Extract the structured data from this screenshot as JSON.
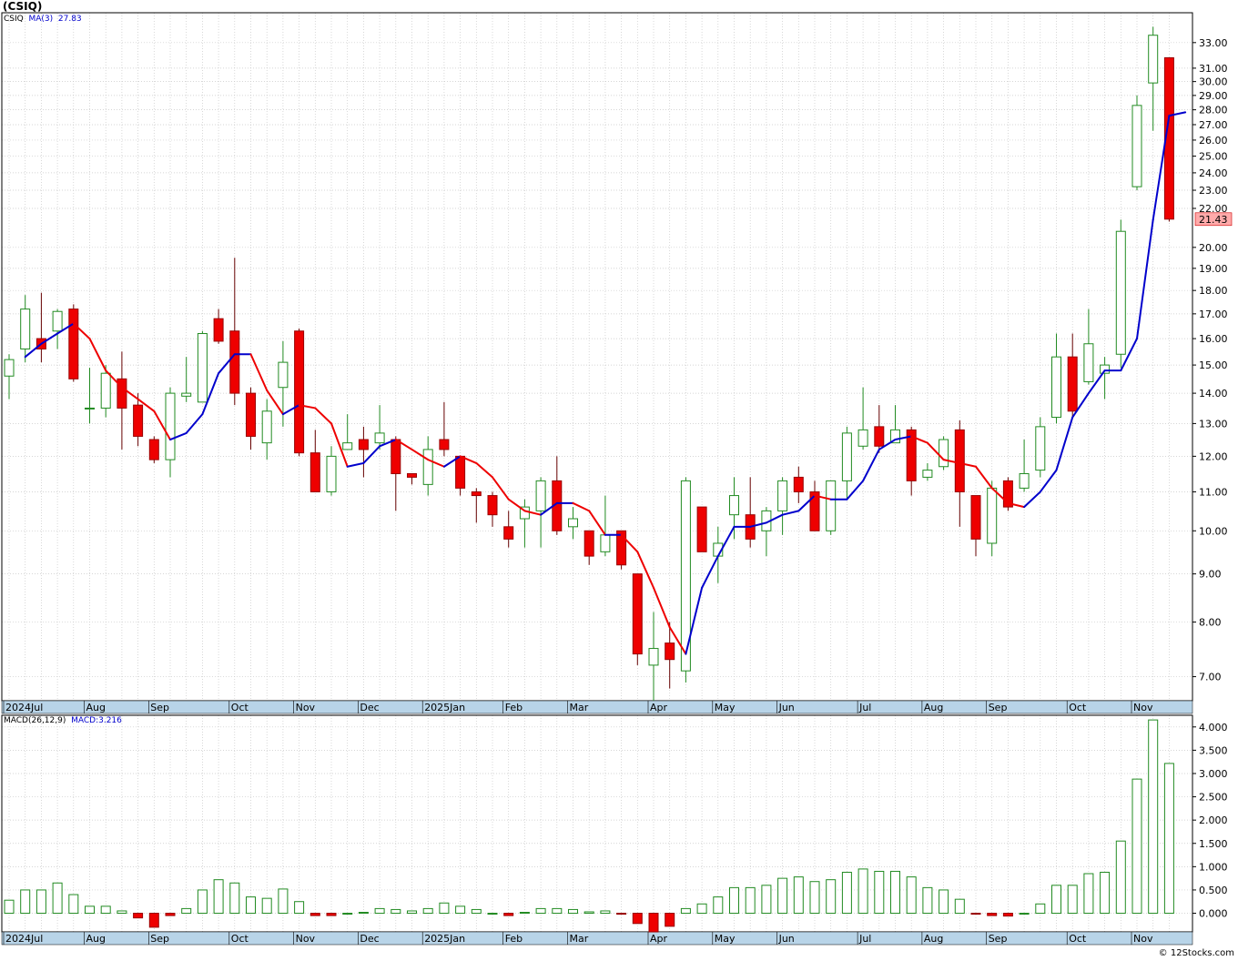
{
  "header": {
    "title": "(CSIQ)",
    "price_symbol": "CSIQ",
    "ma_label": "MA(3)",
    "ma_value": "27.83",
    "macd_label": "MACD(26,12,9)",
    "macd_value": "MACD:3.216",
    "last_price": "21.43",
    "copyright": "© 12Stocks.com"
  },
  "colors": {
    "up_candle": "#228b22",
    "down_candle": "#ee0000",
    "ma_rising": "#0000cc",
    "ma_falling": "#ee0000",
    "axis_band": "#b8d4e8",
    "price_marker": "#ffaaaa"
  },
  "chart_data": {
    "type": "candlestick",
    "y_scale": "log",
    "ylim": [
      6.6,
      35.5
    ],
    "price_ticks": [
      "7.00",
      "8.00",
      "9.00",
      "10.00",
      "11.00",
      "12.00",
      "13.00",
      "14.00",
      "15.00",
      "16.00",
      "17.00",
      "18.00",
      "19.00",
      "20.00",
      "22.00",
      "23.00",
      "24.00",
      "25.00",
      "26.00",
      "27.00",
      "28.00",
      "29.00",
      "30.00",
      "31.00",
      "33.00"
    ],
    "macd_ticks": [
      "0.000",
      "0.500",
      "1.000",
      "1.500",
      "2.000",
      "2.500",
      "3.000",
      "3.500",
      "4.000"
    ],
    "macd_ylim": [
      -0.4,
      4.25
    ],
    "x_labels": [
      {
        "label": "2024Jul",
        "week": 0
      },
      {
        "label": "Aug",
        "week": 5
      },
      {
        "label": "Sep",
        "week": 9
      },
      {
        "label": "Oct",
        "week": 14
      },
      {
        "label": "Nov",
        "week": 18
      },
      {
        "label": "Dec",
        "week": 22
      },
      {
        "label": "2025Jan",
        "week": 26
      },
      {
        "label": "Feb",
        "week": 31
      },
      {
        "label": "Mar",
        "week": 35
      },
      {
        "label": "Apr",
        "week": 40
      },
      {
        "label": "May",
        "week": 44
      },
      {
        "label": "Jun",
        "week": 48
      },
      {
        "label": "Jul",
        "week": 53
      },
      {
        "label": "Aug",
        "week": 57
      },
      {
        "label": "Sep",
        "week": 61
      },
      {
        "label": "Oct",
        "week": 66
      },
      {
        "label": "Nov",
        "week": 70
      }
    ],
    "candles": [
      [
        14.6,
        15.4,
        13.8,
        15.2
      ],
      [
        15.6,
        17.8,
        15.1,
        17.2
      ],
      [
        16.0,
        17.9,
        15.1,
        15.6
      ],
      [
        16.3,
        17.2,
        15.6,
        17.1
      ],
      [
        17.2,
        17.4,
        14.4,
        14.5
      ],
      [
        13.5,
        14.9,
        13.0,
        13.5
      ],
      [
        13.5,
        15.0,
        13.2,
        14.7
      ],
      [
        14.5,
        15.5,
        12.2,
        13.5
      ],
      [
        13.6,
        14.0,
        12.3,
        12.6
      ],
      [
        12.5,
        12.6,
        11.8,
        11.9
      ],
      [
        11.9,
        14.2,
        11.4,
        14.0
      ],
      [
        13.9,
        15.3,
        13.7,
        14.0
      ],
      [
        13.7,
        16.3,
        13.7,
        16.2
      ],
      [
        16.8,
        17.2,
        15.8,
        15.9
      ],
      [
        16.3,
        19.5,
        13.6,
        14.0
      ],
      [
        14.0,
        14.2,
        12.2,
        12.6
      ],
      [
        12.4,
        13.8,
        11.9,
        13.4
      ],
      [
        14.2,
        15.9,
        12.9,
        15.1
      ],
      [
        16.3,
        16.4,
        12.0,
        12.1
      ],
      [
        12.1,
        12.8,
        11.0,
        11.0
      ],
      [
        11.0,
        12.3,
        10.9,
        12.0
      ],
      [
        12.2,
        13.3,
        12.2,
        12.4
      ],
      [
        12.5,
        12.9,
        11.4,
        12.2
      ],
      [
        12.4,
        13.6,
        12.2,
        12.7
      ],
      [
        12.5,
        12.6,
        10.5,
        11.5
      ],
      [
        11.5,
        11.5,
        11.2,
        11.4
      ],
      [
        11.2,
        12.6,
        10.9,
        12.2
      ],
      [
        12.5,
        13.7,
        12.0,
        12.2
      ],
      [
        12.0,
        12.0,
        10.9,
        11.1
      ],
      [
        11.0,
        11.1,
        10.2,
        10.9
      ],
      [
        10.9,
        11.0,
        10.1,
        10.4
      ],
      [
        10.1,
        10.5,
        9.6,
        9.8
      ],
      [
        10.3,
        10.8,
        9.6,
        10.6
      ],
      [
        10.5,
        11.4,
        9.6,
        11.3
      ],
      [
        11.3,
        12.0,
        9.9,
        10.0
      ],
      [
        10.1,
        10.6,
        9.8,
        10.3
      ],
      [
        10.0,
        10.0,
        9.2,
        9.4
      ],
      [
        9.5,
        10.9,
        9.4,
        9.9
      ],
      [
        10.0,
        10.0,
        9.1,
        9.2
      ],
      [
        9.0,
        9.0,
        7.2,
        7.4
      ],
      [
        7.2,
        8.2,
        6.6,
        7.5
      ],
      [
        7.6,
        8.0,
        6.8,
        7.3
      ],
      [
        7.1,
        11.4,
        6.9,
        11.3
      ],
      [
        10.6,
        10.6,
        9.5,
        9.5
      ],
      [
        9.4,
        10.1,
        8.8,
        9.7
      ],
      [
        10.4,
        11.4,
        9.8,
        10.9
      ],
      [
        10.4,
        11.4,
        9.6,
        9.8
      ],
      [
        10.0,
        10.6,
        9.4,
        10.5
      ],
      [
        10.5,
        11.4,
        9.9,
        11.3
      ],
      [
        11.4,
        11.7,
        10.7,
        11.0
      ],
      [
        11.0,
        11.3,
        10.0,
        10.0
      ],
      [
        10.0,
        11.3,
        9.9,
        11.3
      ],
      [
        11.3,
        12.9,
        10.8,
        12.7
      ],
      [
        12.3,
        14.2,
        12.2,
        12.8
      ],
      [
        12.9,
        13.6,
        12.1,
        12.3
      ],
      [
        12.4,
        13.6,
        12.4,
        12.8
      ],
      [
        12.8,
        12.9,
        10.9,
        11.3
      ],
      [
        11.4,
        11.8,
        11.3,
        11.6
      ],
      [
        11.7,
        12.6,
        11.6,
        12.5
      ],
      [
        12.8,
        13.1,
        10.1,
        11.0
      ],
      [
        10.9,
        10.9,
        9.4,
        9.8
      ],
      [
        9.7,
        11.3,
        9.4,
        11.1
      ],
      [
        11.3,
        11.4,
        10.5,
        10.6
      ],
      [
        11.1,
        12.5,
        11.0,
        11.5
      ],
      [
        11.6,
        13.2,
        11.4,
        12.9
      ],
      [
        13.2,
        16.2,
        13.0,
        15.3
      ],
      [
        15.3,
        16.2,
        13.2,
        13.4
      ],
      [
        14.4,
        17.2,
        14.3,
        15.8
      ],
      [
        14.7,
        15.3,
        13.8,
        15.0
      ],
      [
        15.4,
        21.4,
        14.9,
        20.8
      ],
      [
        23.2,
        29.0,
        23.0,
        28.3
      ],
      [
        29.9,
        34.3,
        26.6,
        33.6
      ],
      [
        31.8,
        31.8,
        21.3,
        21.43
      ]
    ],
    "ma3_start": 1,
    "ma3": [
      15.3,
      15.8,
      16.2,
      16.6,
      16.0,
      14.8,
      14.2,
      13.8,
      13.4,
      12.5,
      12.7,
      13.3,
      14.7,
      15.4,
      15.4,
      14.1,
      13.3,
      13.6,
      13.5,
      13.0,
      11.7,
      11.8,
      12.3,
      12.5,
      12.2,
      11.9,
      11.7,
      12.0,
      11.8,
      11.4,
      10.8,
      10.5,
      10.4,
      10.7,
      10.7,
      10.5,
      9.9,
      9.9,
      9.5,
      8.7,
      7.9,
      7.4,
      8.7,
      9.4,
      10.1,
      10.1,
      10.2,
      10.4,
      10.5,
      10.9,
      10.8,
      10.8,
      11.3,
      12.2,
      12.5,
      12.6,
      12.4,
      11.9,
      11.8,
      11.7,
      11.1,
      10.7,
      10.6,
      11.0,
      11.6,
      13.2,
      14.0,
      14.8,
      14.8,
      16.0,
      21.4,
      27.6,
      27.83
    ],
    "macd": [
      0.28,
      0.5,
      0.5,
      0.65,
      0.4,
      0.15,
      0.15,
      0.05,
      -0.1,
      -0.3,
      -0.05,
      0.1,
      0.5,
      0.72,
      0.65,
      0.35,
      0.32,
      0.52,
      0.25,
      -0.05,
      -0.05,
      0.0,
      0.02,
      0.1,
      0.08,
      0.05,
      0.1,
      0.22,
      0.15,
      0.08,
      0.0,
      -0.05,
      0.02,
      0.1,
      0.1,
      0.08,
      0.03,
      0.05,
      -0.02,
      -0.22,
      -0.4,
      -0.28,
      0.1,
      0.2,
      0.35,
      0.55,
      0.55,
      0.6,
      0.75,
      0.78,
      0.68,
      0.72,
      0.88,
      0.95,
      0.9,
      0.9,
      0.78,
      0.55,
      0.5,
      0.3,
      -0.02,
      -0.05,
      -0.06,
      0.0,
      0.2,
      0.6,
      0.6,
      0.85,
      0.88,
      1.55,
      2.88,
      4.15,
      3.216
    ]
  }
}
